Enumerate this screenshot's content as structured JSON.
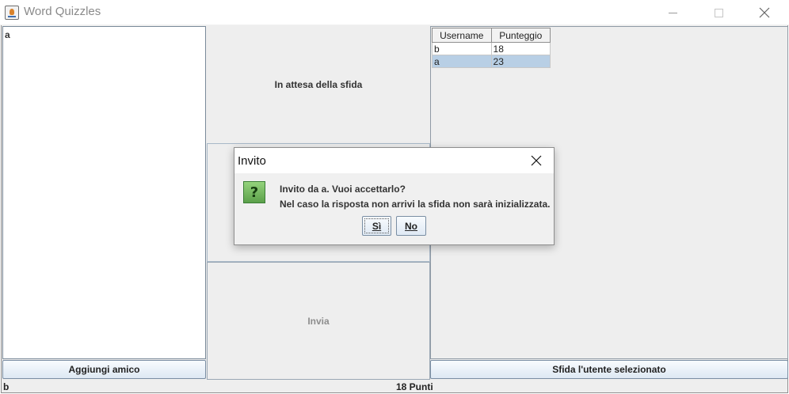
{
  "window": {
    "title": "Word Quizzles"
  },
  "friends": {
    "items": [
      {
        "label": "a"
      }
    ]
  },
  "status": {
    "text": "In attesa della sfida"
  },
  "send": {
    "label": "Invia"
  },
  "ranking": {
    "headers": [
      "Username",
      "Punteggio"
    ],
    "rows": [
      {
        "username": "b",
        "score": "18"
      },
      {
        "username": "a",
        "score": "23",
        "selected": true
      }
    ]
  },
  "buttons": {
    "add_friend": "Aggiungi amico",
    "challenge": "Sfida l'utente selezionato"
  },
  "status_bar": {
    "user": "b",
    "points": "18 Punti"
  },
  "dialog": {
    "title": "Invito",
    "message_line1": "Invito da a. Vuoi accettarlo?",
    "message_line2": "Nel caso la risposta non arrivi la sfida non sarà inizializzata.",
    "yes_label": "Sì",
    "no_label": "No"
  },
  "icons": {
    "app": "java-app-icon",
    "minimize": "minimize-icon",
    "maximize": "maximize-icon",
    "close": "close-icon",
    "question": "question-icon"
  },
  "colors": {
    "panel_background": "#eeeeee",
    "selected_row": "#b8cfe5",
    "question_icon": "#6fb35b"
  }
}
